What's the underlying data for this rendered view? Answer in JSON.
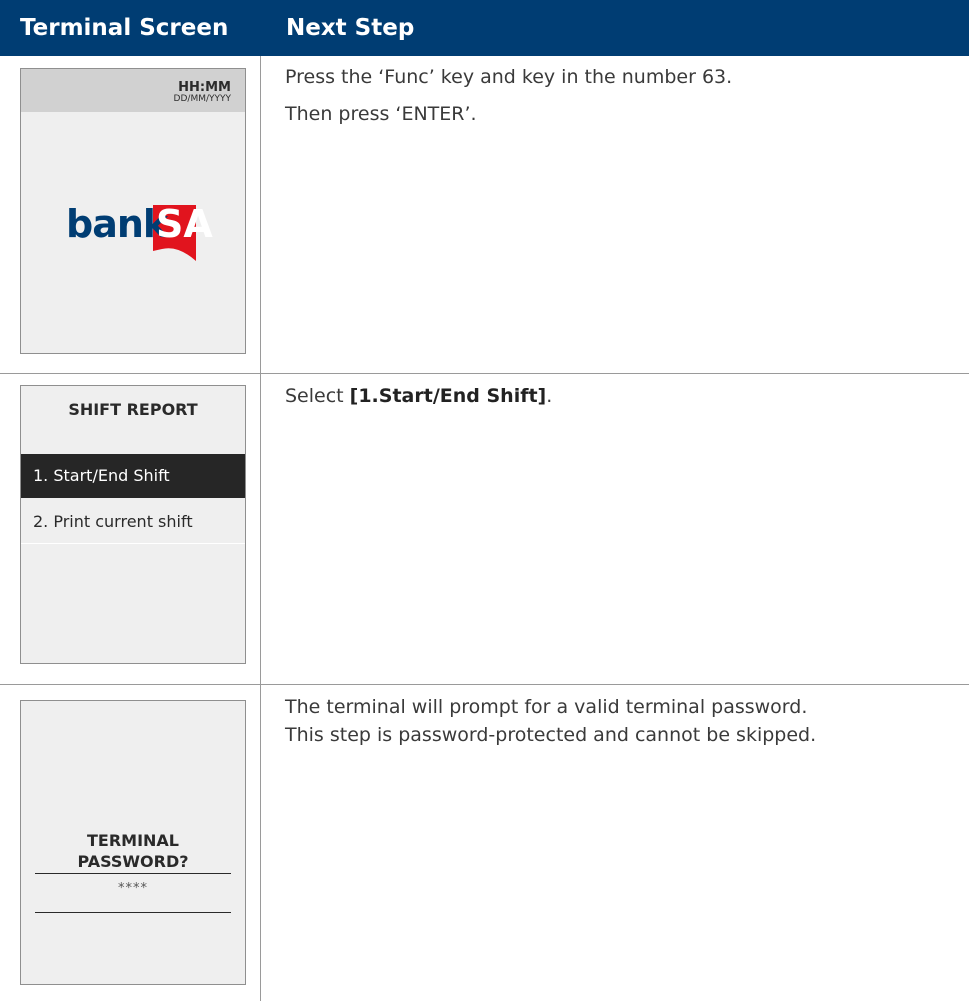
{
  "header": {
    "col_screen": "Terminal Screen",
    "col_step": "Next Step"
  },
  "rows": [
    {
      "screen": {
        "time": "HH:MM",
        "date": "DD/MM/YYYY",
        "logo_text_bank": "bank",
        "logo_text_sa": "SA"
      },
      "step_line1": "Press the ‘Func’ key and key in the number 63.",
      "step_line2": "Then press ‘ENTER’."
    },
    {
      "screen": {
        "title": "SHIFT REPORT",
        "items": [
          "1. Start/End Shift",
          "2. Print current shift"
        ]
      },
      "step_prefix": "Select ",
      "step_bold": "[1.Start/End Shift]",
      "step_suffix": "."
    },
    {
      "screen": {
        "title_line1": "TERMINAL",
        "title_line2": "PASSWORD?",
        "masked": "****"
      },
      "step_line1": "The terminal will prompt for a valid terminal password.",
      "step_line2": "This step is password-protected and cannot be skipped."
    }
  ],
  "colors": {
    "header_bg": "#003d73",
    "brand_red": "#e1141e",
    "brand_blue": "#003d73"
  }
}
